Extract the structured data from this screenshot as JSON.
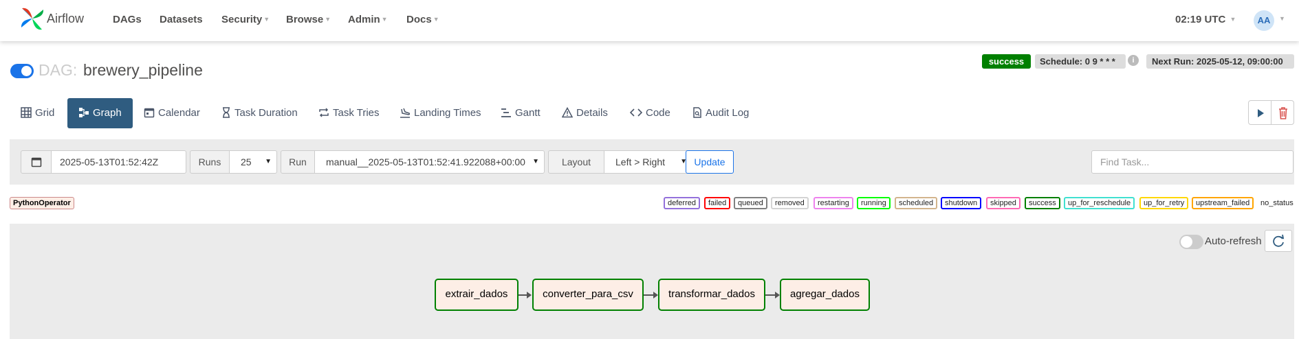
{
  "app": {
    "brand": "Airflow"
  },
  "nav": {
    "items": [
      {
        "label": "DAGs",
        "dropdown": false
      },
      {
        "label": "Datasets",
        "dropdown": false
      },
      {
        "label": "Security",
        "dropdown": true
      },
      {
        "label": "Browse",
        "dropdown": true
      },
      {
        "label": "Admin",
        "dropdown": true
      },
      {
        "label": "Docs",
        "dropdown": true
      }
    ],
    "clock": "02:19 UTC",
    "avatar": "AA"
  },
  "dag": {
    "label": "DAG:",
    "name": "brewery_pipeline",
    "paused": false,
    "status": "success",
    "schedule": "Schedule: 0 9 * * *",
    "next_run": "Next Run: 2025-05-12, 09:00:00"
  },
  "tabs": [
    {
      "label": "Grid",
      "icon": "grid-icon",
      "active": false
    },
    {
      "label": "Graph",
      "icon": "graph-icon",
      "active": true
    },
    {
      "label": "Calendar",
      "icon": "calendar-icon",
      "active": false
    },
    {
      "label": "Task Duration",
      "icon": "hourglass-icon",
      "active": false
    },
    {
      "label": "Task Tries",
      "icon": "retry-icon",
      "active": false
    },
    {
      "label": "Landing Times",
      "icon": "landing-icon",
      "active": false
    },
    {
      "label": "Gantt",
      "icon": "gantt-icon",
      "active": false
    },
    {
      "label": "Details",
      "icon": "warning-triangle-icon",
      "active": false
    },
    {
      "label": "Code",
      "icon": "code-icon",
      "active": false
    },
    {
      "label": "Audit Log",
      "icon": "document-icon",
      "active": false
    }
  ],
  "filters": {
    "base_date": "2025-05-13T01:52:42Z",
    "runs_label": "Runs",
    "runs_value": "25",
    "run_label": "Run",
    "run_value": "manual__2025-05-13T01:52:41.922088+00:00",
    "layout_label": "Layout",
    "layout_value": "Left > Right",
    "update_label": "Update",
    "find_placeholder": "Find Task..."
  },
  "operators": [
    {
      "label": "PythonOperator",
      "color": "#fdeee6"
    }
  ],
  "states": [
    {
      "label": "deferred",
      "color": "#9370db"
    },
    {
      "label": "failed",
      "color": "#ff0000"
    },
    {
      "label": "queued",
      "color": "#808080"
    },
    {
      "label": "removed",
      "color": "#d3d3d3"
    },
    {
      "label": "restarting",
      "color": "#ee82ee"
    },
    {
      "label": "running",
      "color": "#00ff00"
    },
    {
      "label": "scheduled",
      "color": "#d2b48c"
    },
    {
      "label": "shutdown",
      "color": "#0000ff"
    },
    {
      "label": "skipped",
      "color": "#ff69b4"
    },
    {
      "label": "success",
      "color": "#008000"
    },
    {
      "label": "up_for_reschedule",
      "color": "#40e0d0"
    },
    {
      "label": "up_for_retry",
      "color": "#ffd700"
    },
    {
      "label": "upstream_failed",
      "color": "#ffa500"
    },
    {
      "label": "no_status",
      "color": ""
    }
  ],
  "graph": {
    "auto_refresh_label": "Auto-refresh",
    "auto_refresh_on": false,
    "nodes": [
      {
        "label": "extrair_dados",
        "state": "success"
      },
      {
        "label": "converter_para_csv",
        "state": "success"
      },
      {
        "label": "transformar_dados",
        "state": "success"
      },
      {
        "label": "agregar_dados",
        "state": "success"
      }
    ]
  }
}
